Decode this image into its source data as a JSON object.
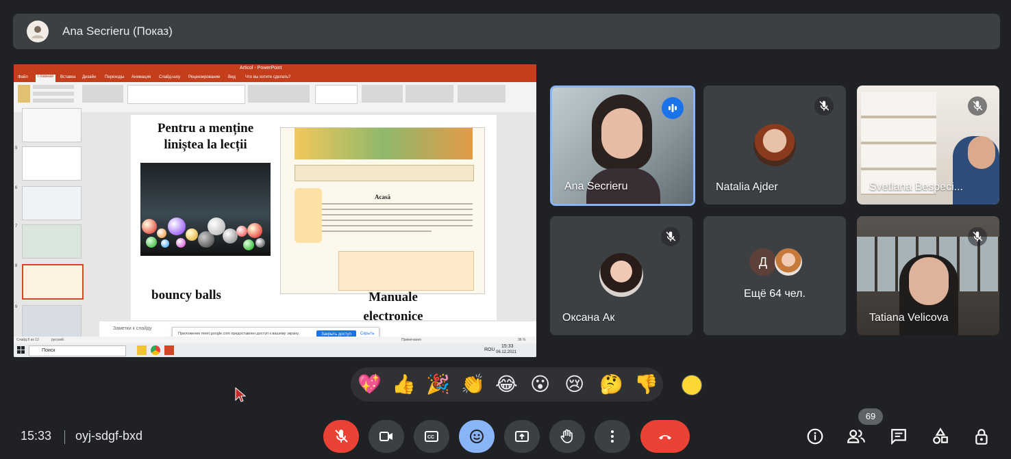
{
  "presenter": {
    "name": "Ana Secrieru (Показ)"
  },
  "screen_share": {
    "app_title": "Articol - PowerPoint",
    "ribbon_tabs": [
      "Файл",
      "Главная",
      "Вставка",
      "Дизайн",
      "Переходы",
      "Анимация",
      "Слайд-шоу",
      "Рецензирование",
      "Вид",
      "Что вы хотите сделать?"
    ],
    "slide_numbers": [
      "5",
      "6",
      "7",
      "8",
      "9"
    ],
    "slide": {
      "title": "Pentru a menține liniștea la lecții",
      "left_caption": "bouncy balls",
      "right_caption": "Manuale electronice",
      "book_title": "Acasă"
    },
    "notes_placeholder": "Заметки к слайду",
    "share_banner": {
      "text": "Приложение meet.google.com предоставлен доступ к вашему экрану.",
      "stop_button": "Закрыть доступ",
      "hide_link": "Скрыть"
    },
    "taskbar": {
      "search_placeholder": "Поиск",
      "time": "15:33",
      "date": "06.12.2021",
      "lang": "ROU"
    },
    "status": {
      "slide_info": "Слайд 8 из 13",
      "lang": "русский",
      "notes": "Примечания",
      "zoom": "38 %"
    }
  },
  "participants": [
    {
      "name": "Ana Secrieru",
      "speaking": true
    },
    {
      "name": "Natalia Ajder",
      "muted": true
    },
    {
      "name": "Svetlana Bespeci...",
      "muted": true
    },
    {
      "name": "Оксана Ак",
      "muted": true
    },
    {
      "name": "Ещё 64 чел.",
      "initial": "Д"
    },
    {
      "name": "Tatiana Velicova",
      "muted": true
    }
  ],
  "reactions": [
    "💖",
    "👍",
    "🎉",
    "👏",
    "😂",
    "😮",
    "😢",
    "🤔",
    "👎"
  ],
  "bottom_bar": {
    "time": "15:33",
    "meeting_code": "oyj-sdgf-bxd",
    "people_count": "69"
  },
  "colors": {
    "background": "#202124",
    "tile": "#3c4043",
    "end_call": "#ea4335",
    "accent": "#8ab4f8",
    "speaking": "#1a73e8"
  },
  "icons": [
    "mic-off-icon",
    "camera-icon",
    "captions-icon",
    "emoji-icon",
    "present-icon",
    "raise-hand-icon",
    "more-options-icon",
    "end-call-icon",
    "info-icon",
    "people-icon",
    "chat-icon",
    "activities-icon",
    "host-controls-icon"
  ]
}
